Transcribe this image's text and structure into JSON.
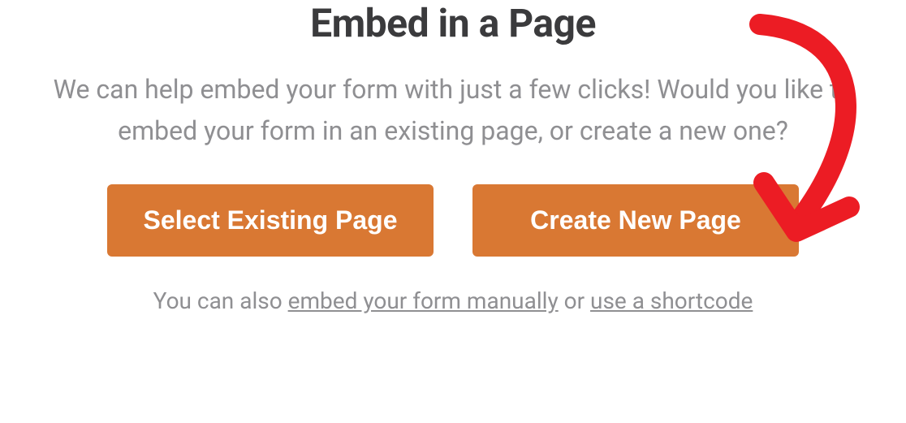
{
  "modal": {
    "title": "Embed in a Page",
    "description": "We can help embed your form with just a few clicks! Would you like to embed your form in an existing page, or create a new one?",
    "buttons": {
      "select_existing_label": "Select Existing Page",
      "create_new_label": "Create New Page"
    },
    "footer": {
      "prefix": "You can also ",
      "link1": "embed your form manually",
      "middle": " or ",
      "link2": "use a shortcode"
    }
  },
  "colors": {
    "button_bg": "#d97833",
    "title_text": "#3b3b3d",
    "body_text": "#8f8f92",
    "annotation": "#ec1c24"
  }
}
